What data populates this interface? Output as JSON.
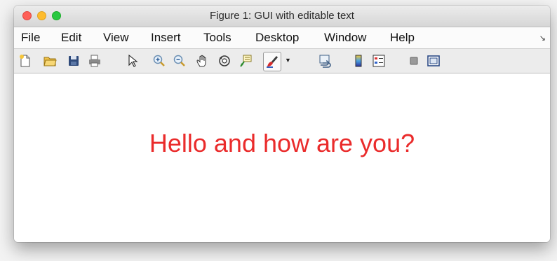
{
  "window": {
    "title": "Figure 1: GUI with editable text"
  },
  "menubar": {
    "items": [
      "File",
      "Edit",
      "View",
      "Insert",
      "Tools",
      "Desktop",
      "Window",
      "Help"
    ],
    "overflow_icon": "dock-arrow-icon"
  },
  "toolbar": {
    "icons": [
      "new-figure-icon",
      "open-file-icon",
      "save-icon",
      "print-icon",
      "select-pointer-icon",
      "zoom-in-icon",
      "zoom-out-icon",
      "pan-hand-icon",
      "rotate-3d-icon",
      "data-cursor-icon",
      "brush-icon",
      "link-plot-icon",
      "insert-colorbar-icon",
      "insert-legend-icon",
      "hide-plot-tools-icon",
      "show-plot-tools-icon"
    ],
    "active": "brush-icon"
  },
  "content": {
    "message": "Hello and how are you?",
    "message_color": "#ea2b2b"
  }
}
